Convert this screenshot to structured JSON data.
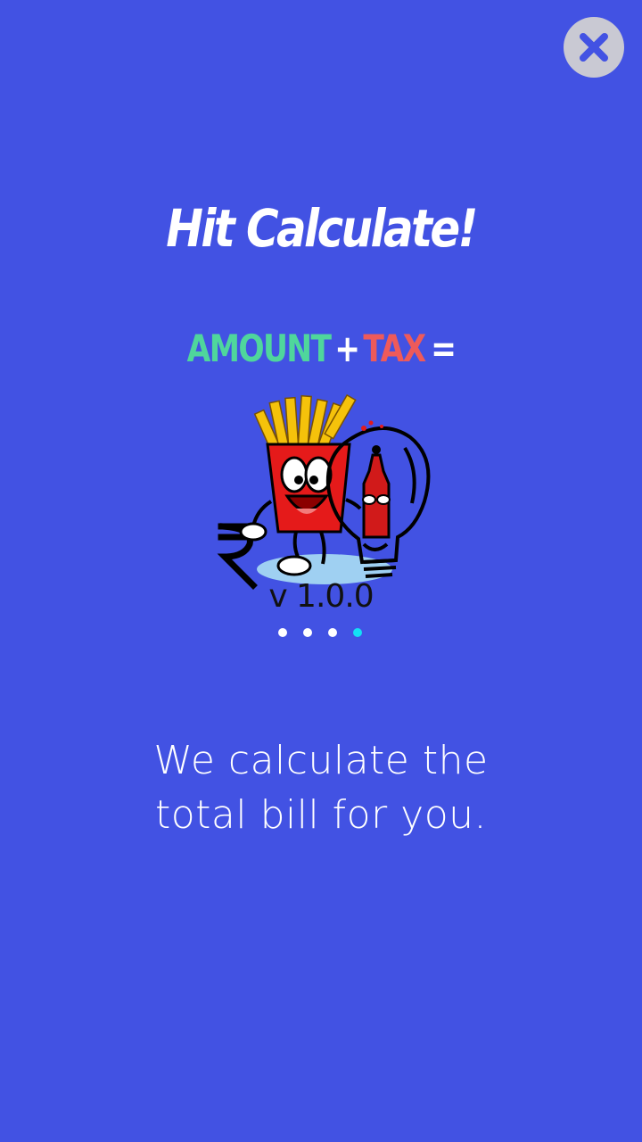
{
  "close_button": {
    "icon": "close-icon",
    "label": "Close"
  },
  "slide": {
    "title": "Hit Calculate!",
    "formula": {
      "amount": "AMOUNT",
      "plus": "+",
      "tax": "TAX",
      "equals": "="
    },
    "logo": {
      "icon": "fries-and-bulb-rupee-logo",
      "version": "v 1.0.0"
    },
    "description": {
      "line1": "We calculate the",
      "line2": "total bill for you."
    }
  },
  "pager": {
    "count": 4,
    "active_index": 3
  },
  "colors": {
    "background": "#4252E3",
    "amount": "#4FD69C",
    "tax": "#EE5A5A",
    "active_dot": "#13E0F5",
    "close_button": "#C9C9D3"
  }
}
